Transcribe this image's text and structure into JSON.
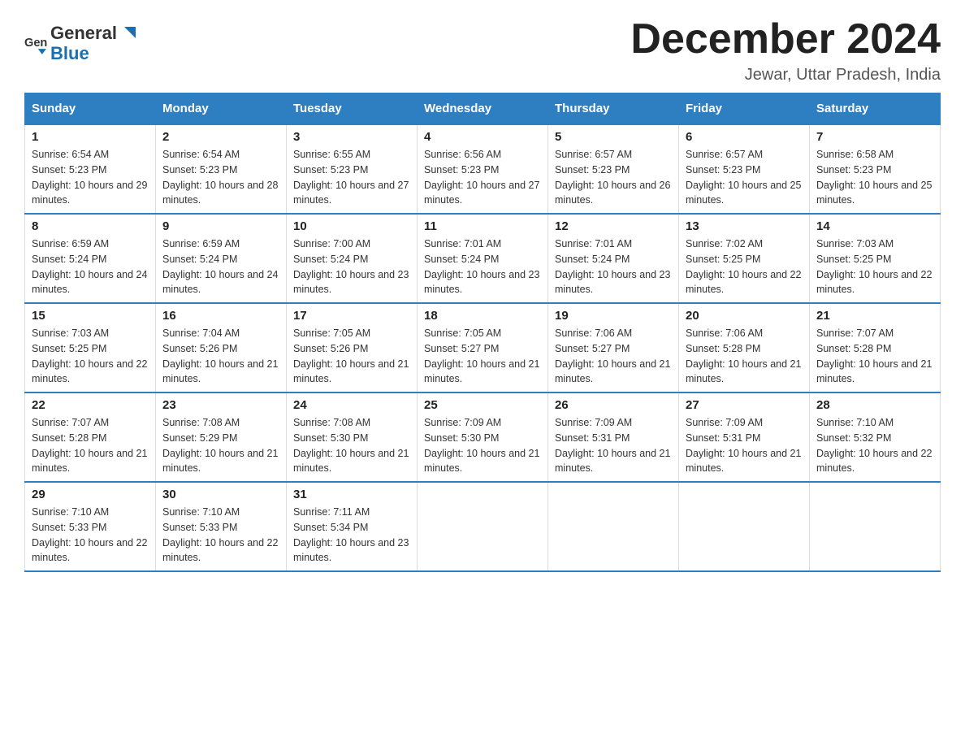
{
  "header": {
    "logo_general": "General",
    "logo_blue": "Blue",
    "month_title": "December 2024",
    "location": "Jewar, Uttar Pradesh, India"
  },
  "weekdays": [
    "Sunday",
    "Monday",
    "Tuesday",
    "Wednesday",
    "Thursday",
    "Friday",
    "Saturday"
  ],
  "weeks": [
    [
      {
        "day": "1",
        "sunrise": "6:54 AM",
        "sunset": "5:23 PM",
        "daylight": "10 hours and 29 minutes."
      },
      {
        "day": "2",
        "sunrise": "6:54 AM",
        "sunset": "5:23 PM",
        "daylight": "10 hours and 28 minutes."
      },
      {
        "day": "3",
        "sunrise": "6:55 AM",
        "sunset": "5:23 PM",
        "daylight": "10 hours and 27 minutes."
      },
      {
        "day": "4",
        "sunrise": "6:56 AM",
        "sunset": "5:23 PM",
        "daylight": "10 hours and 27 minutes."
      },
      {
        "day": "5",
        "sunrise": "6:57 AM",
        "sunset": "5:23 PM",
        "daylight": "10 hours and 26 minutes."
      },
      {
        "day": "6",
        "sunrise": "6:57 AM",
        "sunset": "5:23 PM",
        "daylight": "10 hours and 25 minutes."
      },
      {
        "day": "7",
        "sunrise": "6:58 AM",
        "sunset": "5:23 PM",
        "daylight": "10 hours and 25 minutes."
      }
    ],
    [
      {
        "day": "8",
        "sunrise": "6:59 AM",
        "sunset": "5:24 PM",
        "daylight": "10 hours and 24 minutes."
      },
      {
        "day": "9",
        "sunrise": "6:59 AM",
        "sunset": "5:24 PM",
        "daylight": "10 hours and 24 minutes."
      },
      {
        "day": "10",
        "sunrise": "7:00 AM",
        "sunset": "5:24 PM",
        "daylight": "10 hours and 23 minutes."
      },
      {
        "day": "11",
        "sunrise": "7:01 AM",
        "sunset": "5:24 PM",
        "daylight": "10 hours and 23 minutes."
      },
      {
        "day": "12",
        "sunrise": "7:01 AM",
        "sunset": "5:24 PM",
        "daylight": "10 hours and 23 minutes."
      },
      {
        "day": "13",
        "sunrise": "7:02 AM",
        "sunset": "5:25 PM",
        "daylight": "10 hours and 22 minutes."
      },
      {
        "day": "14",
        "sunrise": "7:03 AM",
        "sunset": "5:25 PM",
        "daylight": "10 hours and 22 minutes."
      }
    ],
    [
      {
        "day": "15",
        "sunrise": "7:03 AM",
        "sunset": "5:25 PM",
        "daylight": "10 hours and 22 minutes."
      },
      {
        "day": "16",
        "sunrise": "7:04 AM",
        "sunset": "5:26 PM",
        "daylight": "10 hours and 21 minutes."
      },
      {
        "day": "17",
        "sunrise": "7:05 AM",
        "sunset": "5:26 PM",
        "daylight": "10 hours and 21 minutes."
      },
      {
        "day": "18",
        "sunrise": "7:05 AM",
        "sunset": "5:27 PM",
        "daylight": "10 hours and 21 minutes."
      },
      {
        "day": "19",
        "sunrise": "7:06 AM",
        "sunset": "5:27 PM",
        "daylight": "10 hours and 21 minutes."
      },
      {
        "day": "20",
        "sunrise": "7:06 AM",
        "sunset": "5:28 PM",
        "daylight": "10 hours and 21 minutes."
      },
      {
        "day": "21",
        "sunrise": "7:07 AM",
        "sunset": "5:28 PM",
        "daylight": "10 hours and 21 minutes."
      }
    ],
    [
      {
        "day": "22",
        "sunrise": "7:07 AM",
        "sunset": "5:28 PM",
        "daylight": "10 hours and 21 minutes."
      },
      {
        "day": "23",
        "sunrise": "7:08 AM",
        "sunset": "5:29 PM",
        "daylight": "10 hours and 21 minutes."
      },
      {
        "day": "24",
        "sunrise": "7:08 AM",
        "sunset": "5:30 PM",
        "daylight": "10 hours and 21 minutes."
      },
      {
        "day": "25",
        "sunrise": "7:09 AM",
        "sunset": "5:30 PM",
        "daylight": "10 hours and 21 minutes."
      },
      {
        "day": "26",
        "sunrise": "7:09 AM",
        "sunset": "5:31 PM",
        "daylight": "10 hours and 21 minutes."
      },
      {
        "day": "27",
        "sunrise": "7:09 AM",
        "sunset": "5:31 PM",
        "daylight": "10 hours and 21 minutes."
      },
      {
        "day": "28",
        "sunrise": "7:10 AM",
        "sunset": "5:32 PM",
        "daylight": "10 hours and 22 minutes."
      }
    ],
    [
      {
        "day": "29",
        "sunrise": "7:10 AM",
        "sunset": "5:33 PM",
        "daylight": "10 hours and 22 minutes."
      },
      {
        "day": "30",
        "sunrise": "7:10 AM",
        "sunset": "5:33 PM",
        "daylight": "10 hours and 22 minutes."
      },
      {
        "day": "31",
        "sunrise": "7:11 AM",
        "sunset": "5:34 PM",
        "daylight": "10 hours and 23 minutes."
      },
      null,
      null,
      null,
      null
    ]
  ]
}
